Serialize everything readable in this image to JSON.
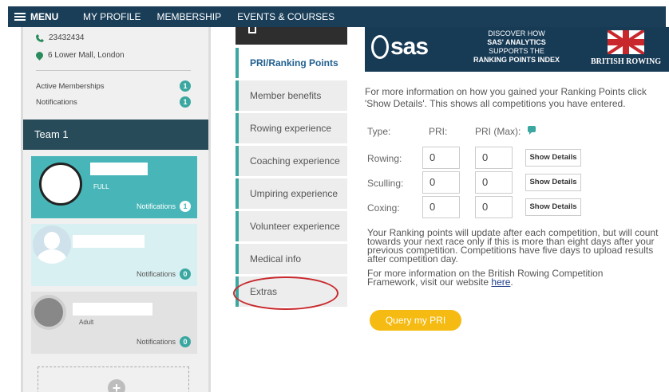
{
  "nav": {
    "menu_label": "MENU",
    "links": [
      "MY PROFILE",
      "MEMBERSHIP",
      "EVENTS & COURSES"
    ]
  },
  "profile": {
    "phone": "23432434",
    "address": "6 Lower Mall, London",
    "active_memberships_label": "Active Memberships",
    "active_memberships_count": "1",
    "notifications_label": "Notifications",
    "notifications_count": "1"
  },
  "team": {
    "name": "Team 1",
    "cards": [
      {
        "sub": "FULL",
        "notif_label": "Notifications",
        "notif_count": "1"
      },
      {
        "sub": "",
        "notif_label": "Notifications",
        "notif_count": "0"
      },
      {
        "sub": "Adult",
        "notif_label": "Notifications",
        "notif_count": "0"
      }
    ]
  },
  "tabs": [
    "PRI/Ranking Points",
    "Member benefits",
    "Rowing experience",
    "Coaching experience",
    "Umpiring experience",
    "Volunteer experience",
    "Medical info",
    "Extras"
  ],
  "banner": {
    "brand": "sas",
    "line1": "DISCOVER HOW",
    "line2": "SAS' ANALYTICS",
    "line3": "SUPPORTS THE",
    "line4": "RANKING POINTS INDEX",
    "partner": "BRITISH ROWING"
  },
  "pri": {
    "intro": "For more information on how you gained your Ranking Points click 'Show Details'. This shows all competitions you have entered.",
    "type_label": "Type:",
    "pri_label": "PRI:",
    "pri_max_label": "PRI (Max):",
    "rows": [
      {
        "label": "Rowing:",
        "pri": "0",
        "max": "0",
        "button": "Show Details"
      },
      {
        "label": "Sculling:",
        "pri": "0",
        "max": "0",
        "button": "Show Details"
      },
      {
        "label": "Coxing:",
        "pri": "0",
        "max": "0",
        "button": "Show Details"
      }
    ],
    "note1": "Your Ranking points will update after each competition, but will count towards your next race only if this is more than eight days after your previous competition. Competitions have five days to upload results after competition day.",
    "note2": "For more information on the British Rowing Competition Framework, visit our website",
    "link": "here",
    "query_button": "Query my PRI"
  },
  "colors": {
    "nav": "#1a3e58",
    "teal": "#3aa7a0",
    "team_bar": "#274b58",
    "query": "#f5bb12",
    "highlight": "#c8282c"
  }
}
